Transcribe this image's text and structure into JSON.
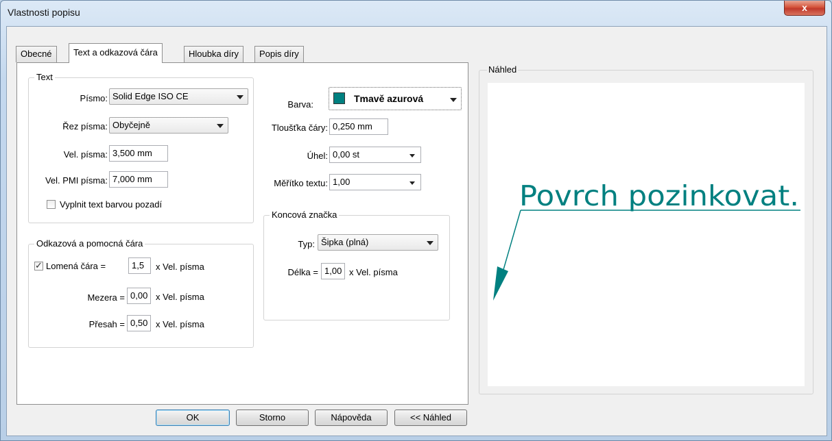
{
  "window": {
    "title": "Vlastnosti popisu",
    "close_glyph": "x"
  },
  "tabs": [
    "Obecné",
    "Text a odkazová čára",
    "Hloubka díry",
    "Popis díry"
  ],
  "text_group": {
    "legend": "Text",
    "font_label": "Písmo:",
    "font_value": "Solid Edge ISO CE",
    "style_label": "Řez písma:",
    "style_value": "Obyčejně",
    "size_label": "Vel. písma:",
    "size_value": "3,500 mm",
    "pmi_size_label": "Vel. PMI písma:",
    "pmi_size_value": "7,000 mm",
    "fill_checkbox_label": "Vyplnit text barvou pozadí",
    "fill_checked": false
  },
  "right_col": {
    "color_label": "Barva:",
    "color_value": "Tmavě azurová",
    "color_hex": "#008080",
    "thickness_label": "Tloušťka čáry:",
    "thickness_value": "0,250 mm",
    "angle_label": "Úhel:",
    "angle_value": "0,00 st",
    "scale_label": "Měřítko textu:",
    "scale_value": "1,00"
  },
  "leader_group": {
    "legend": "Odkazová a pomocná čára",
    "broken_label": "Lomená čára =",
    "broken_value": "1,5",
    "broken_checked": true,
    "gap_label": "Mezera =",
    "gap_value": "0,00",
    "overlap_label": "Přesah =",
    "overlap_value": "0,50",
    "unit_suffix": "x Vel. písma"
  },
  "end_group": {
    "legend": "Koncová značka",
    "type_label": "Typ:",
    "type_value": "Šipka (plná)",
    "length_label": "Délka =",
    "length_value": "1,00",
    "unit_suffix": "x Vel. písma"
  },
  "preview": {
    "legend": "Náhled",
    "text": "Povrch pozinkovat.",
    "color": "#008080"
  },
  "buttons": {
    "ok": "OK",
    "cancel": "Storno",
    "help": "Nápověda",
    "preview": "<< Náhled"
  }
}
